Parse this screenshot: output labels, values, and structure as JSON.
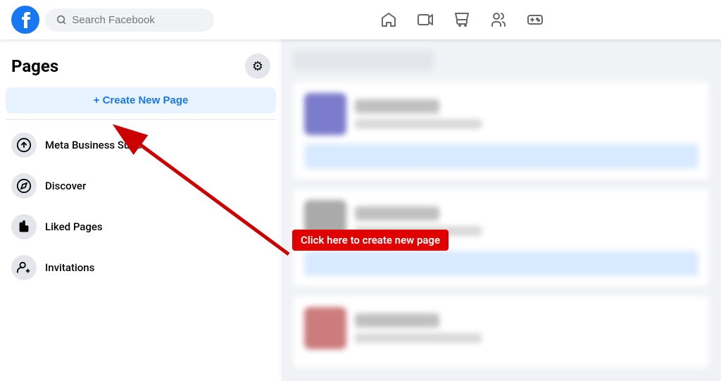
{
  "topNav": {
    "searchPlaceholder": "Search Facebook",
    "icons": [
      {
        "name": "home-icon",
        "label": "Home"
      },
      {
        "name": "video-icon",
        "label": "Watch"
      },
      {
        "name": "marketplace-icon",
        "label": "Marketplace"
      },
      {
        "name": "friends-icon",
        "label": "Friends"
      },
      {
        "name": "gaming-icon",
        "label": "Gaming"
      }
    ]
  },
  "sidebar": {
    "title": "Pages",
    "createButton": "+ Create New Page",
    "items": [
      {
        "id": "meta-business",
        "label": "Meta Business Suite"
      },
      {
        "id": "discover",
        "label": "Discover"
      },
      {
        "id": "liked-pages",
        "label": "Liked Pages"
      },
      {
        "id": "invitations",
        "label": "Invitations"
      }
    ]
  },
  "annotation": {
    "label": "Click here to create new page"
  }
}
